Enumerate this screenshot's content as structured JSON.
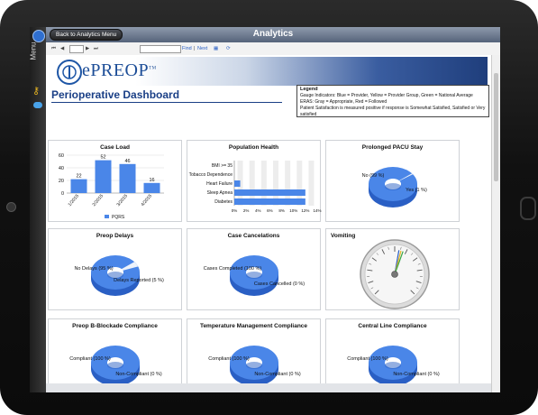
{
  "app": {
    "title": "Analytics",
    "back_button": "Back to Analytics Menu",
    "menu_label": "Menu"
  },
  "toolbar": {
    "find_label": "Find",
    "next_label": "Next"
  },
  "brand": {
    "logo_text": "ePREOP",
    "tm": "TM"
  },
  "dashboard": {
    "title": "Perioperative Dashboard"
  },
  "legend": {
    "title": "Legend",
    "line1": "Gauge Indicators: Blue = Provider, Yellow = Provider Group, Green = National Average",
    "line2": "ERAS: Gray = Appropriate, Red = Followed",
    "line3": "Patient Satisfaction is measured positive if response is Somewhat Satisfied, Satisfied or Very satisfied"
  },
  "panels": {
    "case_load": {
      "title": "Case Load",
      "legend": "PQRS"
    },
    "population_health": {
      "title": "Population Health"
    },
    "pacu": {
      "title": "Prolonged PACU Stay",
      "no": "No (99 %)",
      "yes": "Yes (1 %)"
    },
    "preop_delays": {
      "title": "Preop Delays",
      "a": "No Delays (95 %)",
      "b": "Delays Reported (5 %)"
    },
    "case_cancel": {
      "title": "Case Cancelations",
      "a": "Cases Completed (100 %)",
      "b": "Cases Cancelled (0 %)"
    },
    "vomiting": {
      "title": "Vomiting"
    },
    "b_blockade": {
      "title": "Preop B-Blockade Compliance",
      "a": "Compliant (100 %)",
      "b": "Non-Compliant (0 %)"
    },
    "temp_mgmt": {
      "title": "Temperature Management Compliance",
      "a": "Compliant (100 %)",
      "b": "Non-Compliant (0 %)"
    },
    "central_line": {
      "title": "Central Line Compliance",
      "a": "Compliant (100 %)",
      "b": "Non-Compliant (0 %)"
    }
  },
  "colors": {
    "blue": "#4a86e8",
    "blue_dark": "#2a5fc4",
    "grid": "#dcdcdc"
  },
  "chart_data": [
    {
      "type": "bar",
      "title": "Case Load",
      "categories": [
        "1/2015",
        "2/2015",
        "3/2015",
        "4/2015"
      ],
      "series": [
        {
          "name": "PQRS",
          "values": [
            22,
            52,
            46,
            16
          ]
        }
      ],
      "ylim": [
        0,
        60
      ],
      "yticks": [
        "0",
        "20",
        "40",
        "60"
      ]
    },
    {
      "type": "bar",
      "orientation": "horizontal",
      "title": "Population Health",
      "categories": [
        "BMI >= 35",
        "Tobacco Dependence",
        "Heart Failure",
        "Sleep Apnea",
        "Diabetes"
      ],
      "values": [
        0,
        0,
        1,
        12,
        12
      ],
      "xlim": [
        0,
        14
      ],
      "xticks": [
        "0%",
        "2%",
        "4%",
        "6%",
        "8%",
        "10%",
        "12%",
        "14%"
      ]
    },
    {
      "type": "pie",
      "title": "Prolonged PACU Stay",
      "labels": [
        "No",
        "Yes"
      ],
      "values": [
        99,
        1
      ]
    },
    {
      "type": "pie",
      "title": "Preop Delays",
      "labels": [
        "No Delays",
        "Delays Reported"
      ],
      "values": [
        95,
        5
      ]
    },
    {
      "type": "pie",
      "title": "Case Cancelations",
      "labels": [
        "Cases Completed",
        "Cases Cancelled"
      ],
      "values": [
        100,
        0
      ]
    },
    {
      "type": "pie",
      "title": "Preop B-Blockade Compliance",
      "labels": [
        "Compliant",
        "Non-Compliant"
      ],
      "values": [
        100,
        0
      ]
    },
    {
      "type": "pie",
      "title": "Temperature Management Compliance",
      "labels": [
        "Compliant",
        "Non-Compliant"
      ],
      "values": [
        100,
        0
      ]
    },
    {
      "type": "pie",
      "title": "Central Line Compliance",
      "labels": [
        "Compliant",
        "Non-Compliant"
      ],
      "values": [
        100,
        0
      ]
    }
  ]
}
